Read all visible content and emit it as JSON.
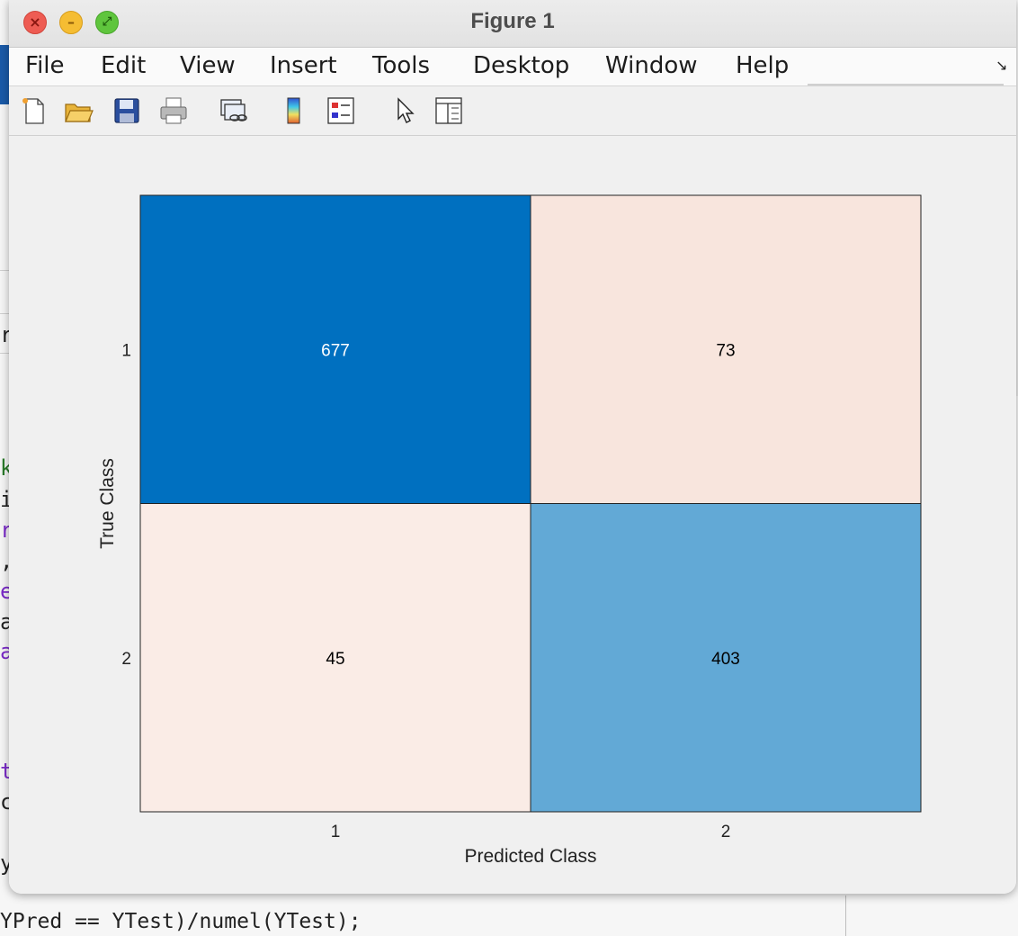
{
  "window": {
    "title": "Figure 1"
  },
  "menu": [
    "File",
    "Edit",
    "View",
    "Insert",
    "Tools",
    "Desktop",
    "Window",
    "Help"
  ],
  "toolbar": {
    "icons": [
      "new-figure-icon",
      "open-file-icon",
      "save-icon",
      "print-icon",
      "link-plot-icon",
      "colorbar-icon",
      "legend-icon",
      "pointer-icon",
      "property-inspector-icon"
    ]
  },
  "background": {
    "code_fragments": [
      "r",
      "k",
      "i",
      "r",
      ",",
      "e",
      "a",
      "a",
      "t",
      "c",
      "y"
    ],
    "bottom_code": "YPred == YTest)/numel(YTest);"
  },
  "chart_data": {
    "type": "heatmap",
    "xlabel": "Predicted Class",
    "ylabel": "True Class",
    "x_categories": [
      "1",
      "2"
    ],
    "y_categories": [
      "1",
      "2"
    ],
    "values": [
      [
        677,
        73
      ],
      [
        45,
        403
      ]
    ],
    "cell_colors": [
      [
        "#0070c0",
        "#f8e5dd"
      ],
      [
        "#faece6",
        "#62a9d6"
      ]
    ],
    "text_colors": [
      [
        "#ffffff",
        "#000000"
      ],
      [
        "#000000",
        "#000000"
      ]
    ]
  }
}
